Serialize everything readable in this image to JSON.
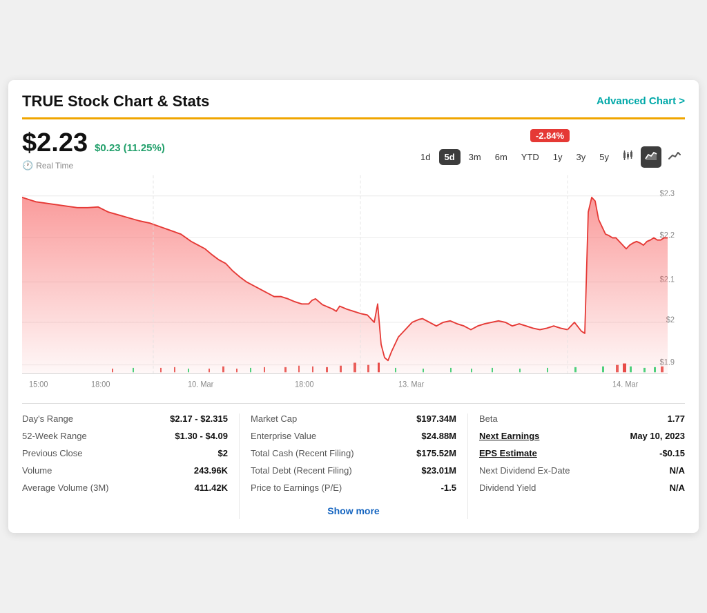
{
  "header": {
    "title": "TRUE Stock Chart & Stats",
    "advanced_chart_label": "Advanced Chart >"
  },
  "price": {
    "main": "$2.23",
    "change": "$0.23 (11.25%)",
    "realtime": "Real Time"
  },
  "change_badge": "-2.84%",
  "time_buttons": [
    {
      "label": "1d",
      "active": false
    },
    {
      "label": "5d",
      "active": true
    },
    {
      "label": "3m",
      "active": false
    },
    {
      "label": "6m",
      "active": false
    },
    {
      "label": "YTD",
      "active": false
    },
    {
      "label": "1y",
      "active": false
    },
    {
      "label": "3y",
      "active": false
    },
    {
      "label": "5y",
      "active": false
    }
  ],
  "chart": {
    "y_labels": [
      "$2.3",
      "$2.2",
      "$2.1",
      "$2",
      "$1.9"
    ],
    "x_labels": [
      "15:00",
      "18:00",
      "10. Mar",
      "18:00",
      "13. Mar",
      "14. Mar"
    ]
  },
  "stats": {
    "col1": [
      {
        "label": "Day's Range",
        "value": "$2.17 - $2.315"
      },
      {
        "label": "52-Week Range",
        "value": "$1.30 - $4.09"
      },
      {
        "label": "Previous Close",
        "value": "$2"
      },
      {
        "label": "Volume",
        "value": "243.96K"
      },
      {
        "label": "Average Volume (3M)",
        "value": "411.42K"
      }
    ],
    "col2": [
      {
        "label": "Market Cap",
        "value": "$197.34M"
      },
      {
        "label": "Enterprise Value",
        "value": "$24.88M"
      },
      {
        "label": "Total Cash (Recent Filing)",
        "value": "$175.52M"
      },
      {
        "label": "Total Debt (Recent Filing)",
        "value": "$23.01M"
      },
      {
        "label": "Price to Earnings (P/E)",
        "value": "-1.5"
      }
    ],
    "col3": [
      {
        "label": "Beta",
        "value": "1.77"
      },
      {
        "label": "Next Earnings",
        "value": "May 10, 2023",
        "link": true
      },
      {
        "label": "EPS Estimate",
        "value": "-$0.15",
        "link": true
      },
      {
        "label": "Next Dividend Ex-Date",
        "value": "N/A"
      },
      {
        "label": "Dividend Yield",
        "value": "N/A"
      }
    ]
  },
  "show_more_label": "Show more"
}
